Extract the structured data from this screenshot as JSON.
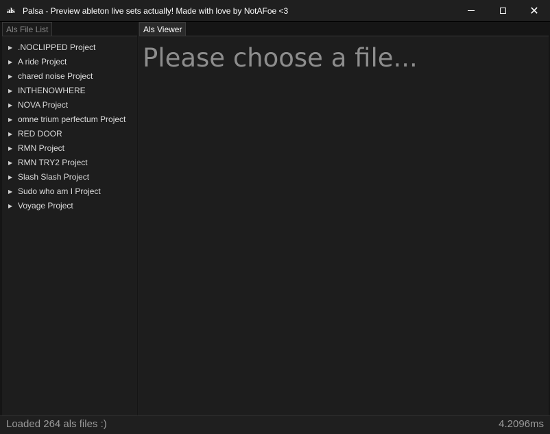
{
  "window": {
    "icon": "als",
    "title": "Palsa - Preview ableton live sets actually! Made with love by NotAFoe <3"
  },
  "left_panel": {
    "tab": "Als File List",
    "items": [
      ".NOCLIPPED Project",
      "A ride Project",
      "chared noise Project",
      "INTHENOWHERE",
      "NOVA Project",
      "omne trium perfectum Project",
      "RED DOOR",
      "RMN Project",
      "RMN TRY2 Project",
      "Slash Slash Project",
      "Sudo who am I Project",
      "Voyage Project"
    ]
  },
  "right_panel": {
    "tab": "Als Viewer",
    "placeholder": "Please choose a file..."
  },
  "status": {
    "left": "Loaded 264 als files :)",
    "right": "4.2096ms"
  }
}
